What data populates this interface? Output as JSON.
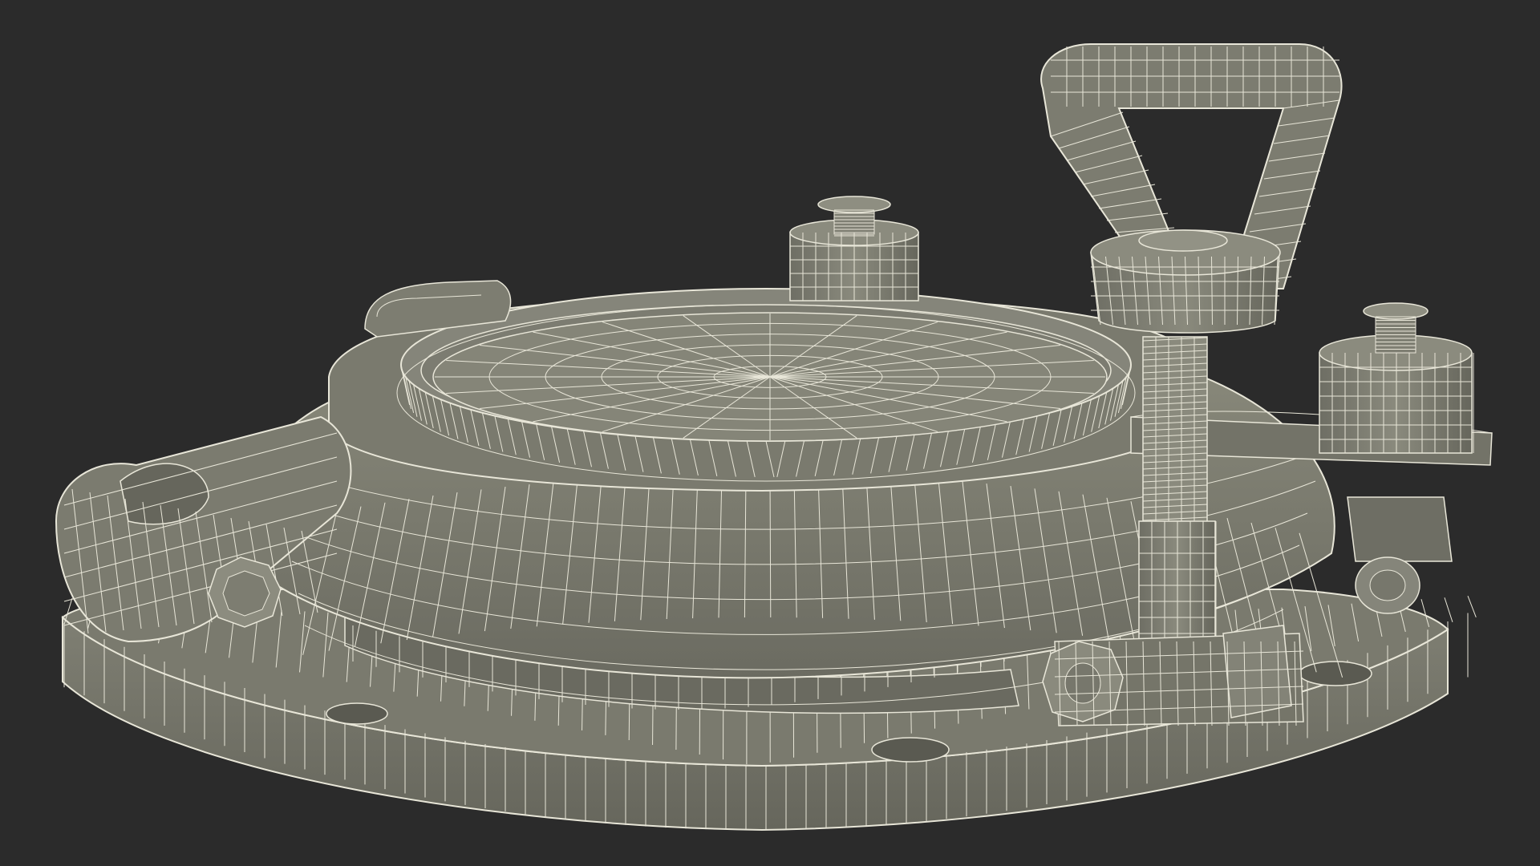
{
  "scene": {
    "subject": "porthole-hatch-wireframe",
    "colors": {
      "background": "#2b2b2b",
      "surface": "#7d7d71",
      "surface_dark": "#5f5f56",
      "surface_light": "#8d8d80",
      "wire": "#e8e6d8"
    }
  }
}
